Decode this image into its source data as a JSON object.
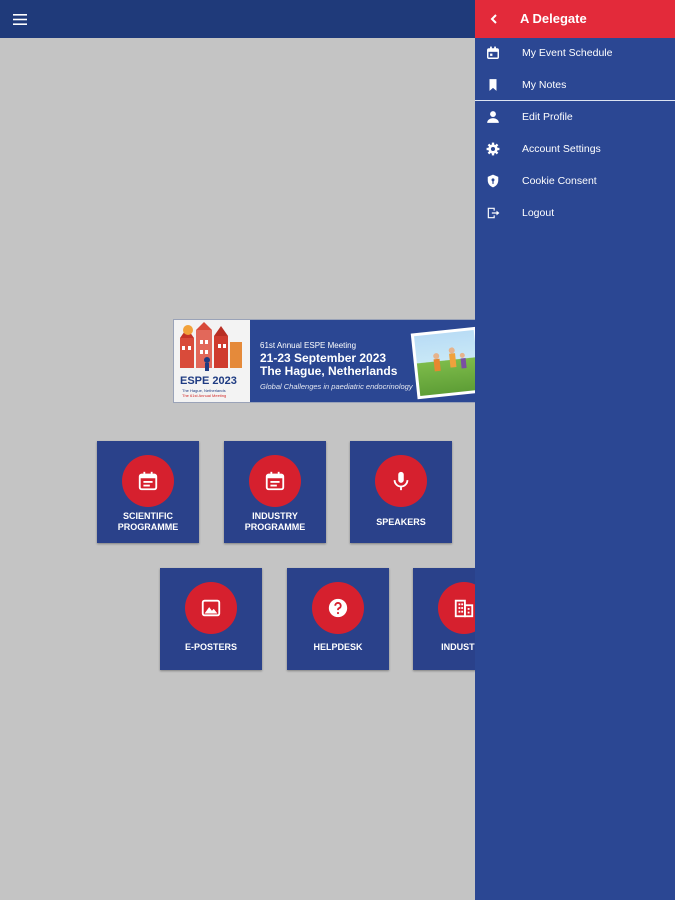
{
  "header": {
    "menu_icon": "hamburger-menu-icon"
  },
  "banner": {
    "line1": "61st Annual ESPE Meeting",
    "line2": "21-23 September 2023",
    "line3": "The Hague, Netherlands",
    "tagline": "Global Challenges in paediatric endocrinology",
    "logo_text": "ESPE 2023",
    "logo_sub1": "The Hague, Netherlands",
    "logo_sub2": "The 61st Annual Meeting"
  },
  "tiles": [
    {
      "label": "SCIENTIFIC\nPROGRAMME",
      "icon": "calendar-icon"
    },
    {
      "label": "INDUSTRY\nPROGRAMME",
      "icon": "calendar-icon"
    },
    {
      "label": "SPEAKERS",
      "icon": "microphone-icon"
    },
    {
      "label": "E-POSTERS",
      "icon": "image-icon"
    },
    {
      "label": "HELPDESK",
      "icon": "question-icon"
    },
    {
      "label": "INDUSTRY",
      "icon": "building-icon"
    }
  ],
  "drawer": {
    "title": "A Delegate",
    "back_icon": "chevron-left-icon",
    "items": [
      {
        "label": "My Event Schedule",
        "icon": "calendar-icon"
      },
      {
        "label": "My Notes",
        "icon": "bookmark-icon"
      },
      {
        "label": "Edit Profile",
        "icon": "person-icon"
      },
      {
        "label": "Account Settings",
        "icon": "gear-icon"
      },
      {
        "label": "Cookie Consent",
        "icon": "shield-icon"
      },
      {
        "label": "Logout",
        "icon": "logout-icon"
      }
    ]
  },
  "colors": {
    "topbar": "#1f3a7a",
    "drawer": "#2b4793",
    "drawer_header": "#e32a3a",
    "tile": "#2a418a",
    "tile_circle": "#d6202e",
    "background": "#c4c4c4"
  }
}
